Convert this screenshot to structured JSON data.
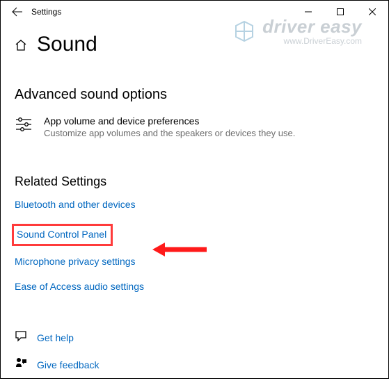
{
  "titlebar": {
    "app_name": "Settings"
  },
  "header": {
    "title": "Sound"
  },
  "advanced": {
    "heading": "Advanced sound options",
    "pref_title": "App volume and device preferences",
    "pref_desc": "Customize app volumes and the speakers or devices they use."
  },
  "related": {
    "heading": "Related Settings",
    "links": {
      "bluetooth": "Bluetooth and other devices",
      "sound_control": "Sound Control Panel",
      "microphone": "Microphone privacy settings",
      "ease_access": "Ease of Access audio settings"
    }
  },
  "help": {
    "get_help": "Get help",
    "feedback": "Give feedback"
  },
  "watermark": {
    "brand": "driver easy",
    "url": "www.DriverEasy.com"
  }
}
